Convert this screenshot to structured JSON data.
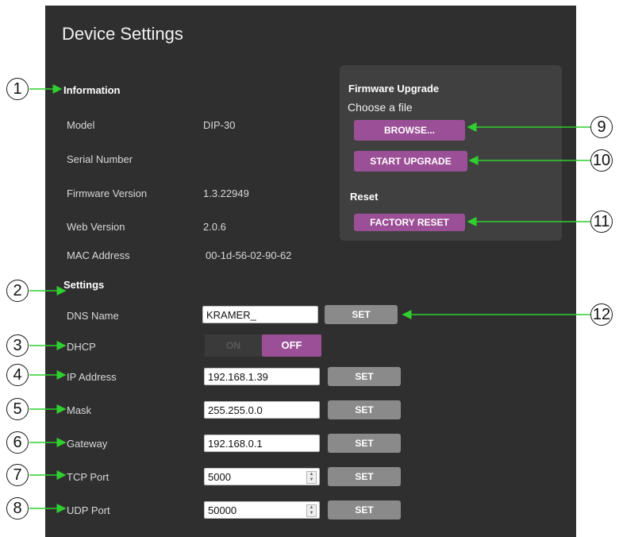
{
  "title": "Device Settings",
  "info": {
    "heading": "Information",
    "rows": [
      {
        "label": "Model",
        "value": "DIP-30"
      },
      {
        "label": "Serial Number",
        "value": ""
      },
      {
        "label": "Firmware Version",
        "value": "1.3.22949"
      },
      {
        "label": "Web Version",
        "value": "2.0.6"
      },
      {
        "label": "MAC Address",
        "value": "00-1d-56-02-90-62"
      }
    ]
  },
  "settings": {
    "heading": "Settings",
    "dns_label": "DNS Name",
    "dns_value": "KRAMER_",
    "dhcp_label": "DHCP",
    "dhcp_on": "ON",
    "dhcp_off": "OFF",
    "ip_label": "IP Address",
    "ip_value": "192.168.1.39",
    "mask_label": "Mask",
    "mask_value": "255.255.0.0",
    "gateway_label": "Gateway",
    "gateway_value": "192.168.0.1",
    "tcp_label": "TCP Port",
    "tcp_value": "5000",
    "udp_label": "UDP Port",
    "udp_value": "50000",
    "set_label": "SET"
  },
  "firmware": {
    "heading": "Firmware Upgrade",
    "choose_label": "Choose a file",
    "browse_label": "BROWSE...",
    "start_label": "START UPGRADE",
    "reset_heading": "Reset",
    "factory_reset_label": "FACTORY RESET"
  },
  "callouts": [
    "1",
    "2",
    "3",
    "4",
    "5",
    "6",
    "7",
    "8",
    "9",
    "10",
    "11",
    "12"
  ],
  "colors": {
    "accent": "#9b4f96",
    "panel": "#2f2f2f",
    "arrow": "#2fcf2f"
  }
}
